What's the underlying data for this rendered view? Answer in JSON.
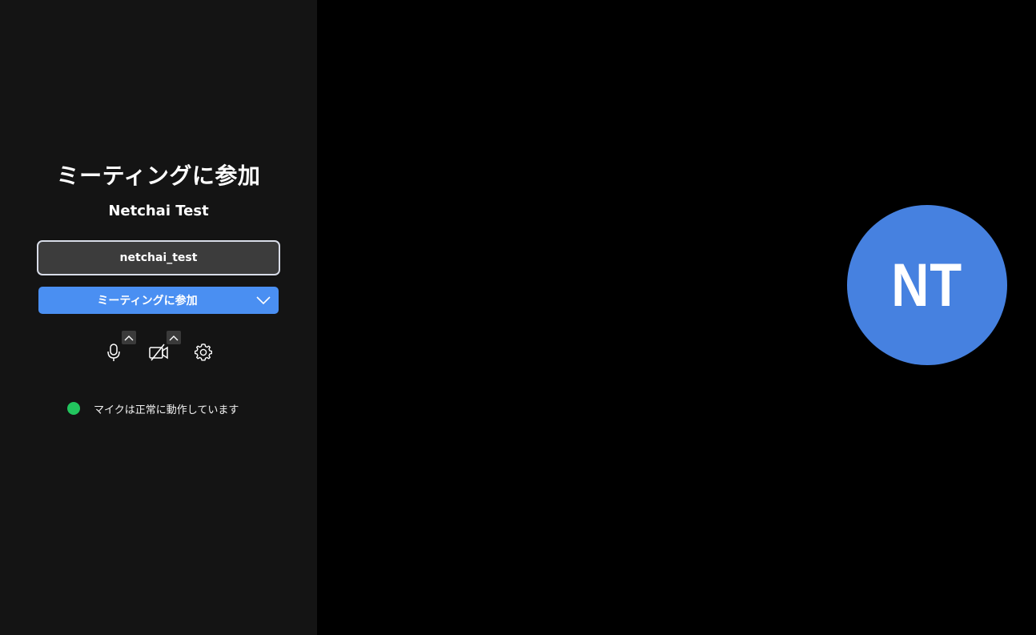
{
  "join_panel": {
    "title": "ミーティングに参加",
    "meeting_name": "Netchai Test",
    "name_input_value": "netchai_test",
    "join_button_label": "ミーティングに参加",
    "status_text": "マイクは正常に動作しています",
    "status_color": "#22c55e"
  },
  "controls": {
    "mic_icon": "microphone-icon",
    "camera_icon": "camera-off-icon",
    "settings_icon": "gear-icon"
  },
  "preview": {
    "avatar_initials": "NT",
    "avatar_color": "#4681e0"
  },
  "colors": {
    "accent": "#4a8ff2",
    "panel_bg": "#141414",
    "preview_bg": "#000000"
  }
}
